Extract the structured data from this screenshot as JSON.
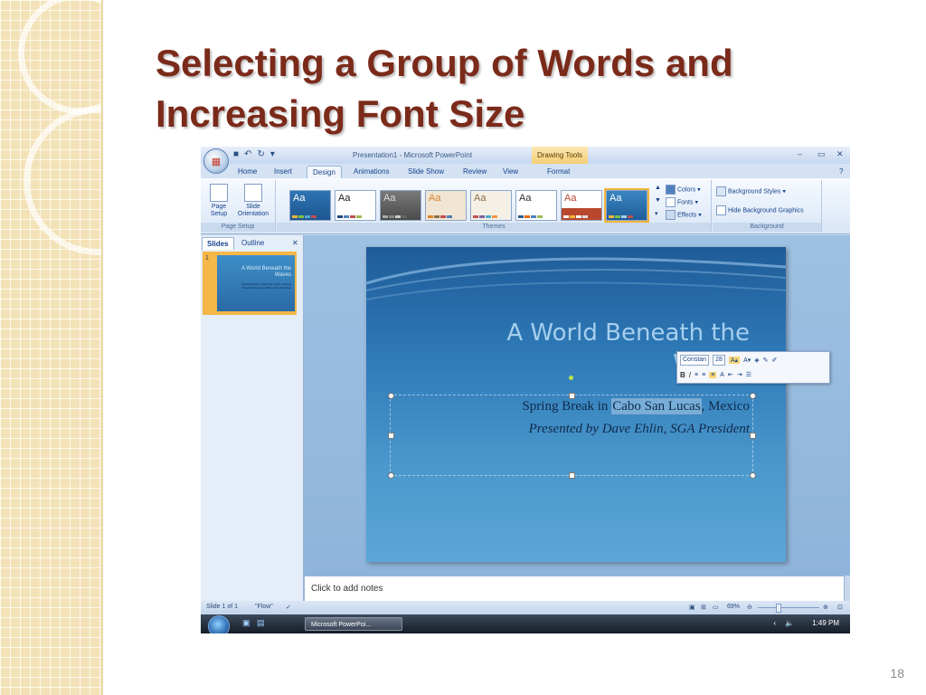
{
  "title_lines": [
    "Selecting a Group of Words and",
    "Increasing Font Size"
  ],
  "slide_number": "18",
  "ppt": {
    "window_title": "Presentation1 - Microsoft PowerPoint",
    "contextual_tab": "Drawing Tools",
    "tabs": [
      "Home",
      "Insert",
      "Design",
      "Animations",
      "Slide Show",
      "Review",
      "View",
      "Format"
    ],
    "active_tab": "Design",
    "page_setup": {
      "page_setup": "Page Setup",
      "orientation": "Slide Orientation",
      "group_label": "Page Setup"
    },
    "themes_label": "Themes",
    "theme_sample": "Aa",
    "theme_cmds": {
      "colors": "Colors",
      "fonts": "Fonts",
      "effects": "Effects"
    },
    "background": {
      "styles": "Background Styles",
      "hide": "Hide Background Graphics",
      "group_label": "Background"
    },
    "panel_tabs": [
      "Slides",
      "Outline"
    ],
    "thumb_number": "1",
    "slide": {
      "title_lines": [
        "A World Beneath the",
        "Waves"
      ],
      "sub1_before": "Spring Break in ",
      "sub1_selected": "Cabo San Lucas",
      "sub1_after": ", Mexico",
      "sub2": "Presented by Dave Ehlin, SGA President"
    },
    "mini_toolbar": {
      "font": "Constan",
      "size": "28"
    },
    "notes_placeholder": "Click to add notes",
    "status": {
      "slide_of": "Slide 1 of 1",
      "theme": "\"Flow\"",
      "zoom": "69%"
    },
    "taskbar": {
      "task": "Microsoft PowerPoi...",
      "time": "1:49 PM"
    },
    "colors": {
      "title": "#7b2a1a",
      "accent": "#f3b43b",
      "ribbon": "#d4e2f3"
    }
  }
}
